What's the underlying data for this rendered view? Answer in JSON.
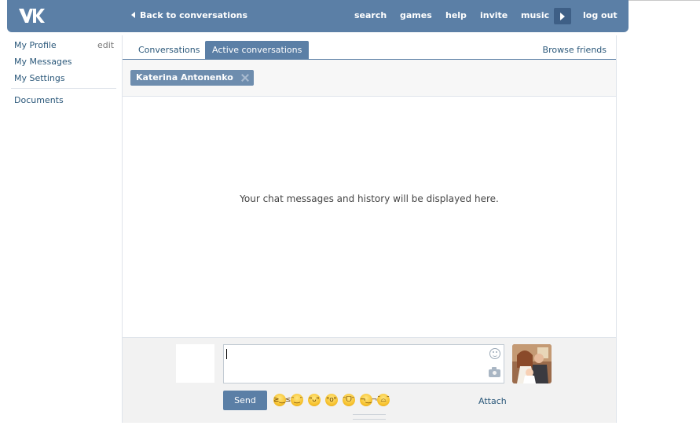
{
  "header": {
    "logo_icon": "vk-logo-icon",
    "back_label": "Back to conversations",
    "nav": [
      "search",
      "games",
      "help",
      "invite",
      "music",
      "log out"
    ]
  },
  "sidebar": {
    "items": [
      {
        "label": "My Profile"
      },
      {
        "label": "My Messages"
      },
      {
        "label": "My Settings"
      },
      {
        "label": "Documents"
      }
    ],
    "edit_label": "edit"
  },
  "tabs": {
    "items": [
      {
        "label": "Conversations",
        "active": false
      },
      {
        "label": "Active conversations",
        "active": true
      }
    ],
    "browse_label": "Browse friends"
  },
  "chat": {
    "participant": "Katerina Antonenko",
    "empty_message": "Your chat messages and history will be displayed here."
  },
  "composer": {
    "input_value": "",
    "send_label": "Send",
    "attach_label": "Attach",
    "emojis": [
      "laughing",
      "smiling",
      "grinning",
      "surprised",
      "beaming",
      "smirking",
      "sweating"
    ]
  },
  "colors": {
    "brand": "#5b7fa6",
    "link": "#2b587a",
    "chip": "#6e8dae"
  }
}
